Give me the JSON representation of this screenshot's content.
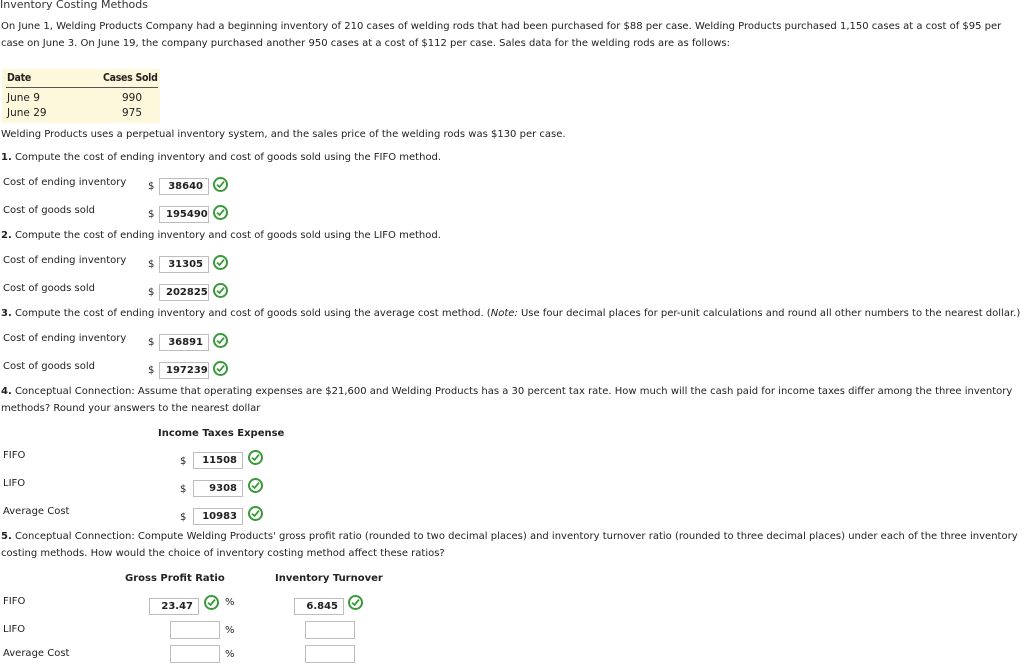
{
  "title": "Inventory Costing Methods",
  "intro": "On June 1, Welding Products Company had a beginning inventory of 210 cases of welding rods that had been purchased for $88 per case. Welding Products purchased 1,150 cases at a cost of $95 per case on June 3. On June 19, the company purchased another 950 cases at a cost of $112 per case. Sales data for the welding rods are as follows:",
  "sales_table": {
    "headers": [
      "Date",
      "Cases Sold"
    ],
    "rows": [
      {
        "date": "June 9",
        "cases": "990"
      },
      {
        "date": "June 29",
        "cases": "975"
      }
    ]
  },
  "system_note": "Welding Products uses a perpetual inventory system, and the sales price of the welding rods was $130 per case.",
  "q1": {
    "num": "1.",
    "text": "Compute the cost of ending inventory and cost of goods sold using the FIFO method.",
    "ending_label": "Cost of ending inventory",
    "ending_value": "38640",
    "cogs_label": "Cost of goods sold",
    "cogs_value": "195490"
  },
  "q2": {
    "num": "2.",
    "text": "Compute the cost of ending inventory and cost of goods sold using the LIFO method.",
    "ending_label": "Cost of ending inventory",
    "ending_value": "31305",
    "cogs_label": "Cost of goods sold",
    "cogs_value": "202825"
  },
  "q3": {
    "num": "3.",
    "text_before": "Compute the cost of ending inventory and cost of goods sold using the average cost method. (",
    "note_label": "Note:",
    "text_after": " Use four decimal places for per-unit calculations and round all other numbers to the nearest dollar.)",
    "ending_label": "Cost of ending inventory",
    "ending_value": "36891",
    "cogs_label": "Cost of goods sold",
    "cogs_value": "197239"
  },
  "q4": {
    "num": "4.",
    "line1": "Conceptual Connection: Assume that operating expenses are $21,600 and Welding Products has a 30 percent tax rate. How much will the cash paid for income taxes differ among the three inventory",
    "line2": "methods? Round your answers to the nearest dollar",
    "col_header": "Income Taxes Expense",
    "rows": [
      {
        "label": "FIFO",
        "value": "11508"
      },
      {
        "label": "LIFO",
        "value": "9308"
      },
      {
        "label": "Average Cost",
        "value": "10983"
      }
    ]
  },
  "q5": {
    "num": "5.",
    "line1": "Conceptual Connection: Compute Welding Products' gross profit ratio (rounded to two decimal places) and inventory turnover ratio (rounded to three decimal places) under each of the three inventory",
    "line2": "costing methods. How would the choice of inventory costing method affect these ratios?",
    "col_gross": "Gross Profit Ratio",
    "col_turnover": "Inventory Turnover",
    "rows": [
      {
        "label": "FIFO",
        "gross": "23.47",
        "turnover": "6.845"
      },
      {
        "label": "LIFO",
        "gross": "",
        "turnover": ""
      },
      {
        "label": "Average Cost",
        "gross": "",
        "turnover": ""
      }
    ]
  },
  "symbols": {
    "dollar": "$",
    "percent": "%"
  },
  "icons": {
    "correct": "check-circle-icon"
  },
  "colors": {
    "check_green": "#3a9a3a",
    "table_bg": "#fdf8dc"
  }
}
